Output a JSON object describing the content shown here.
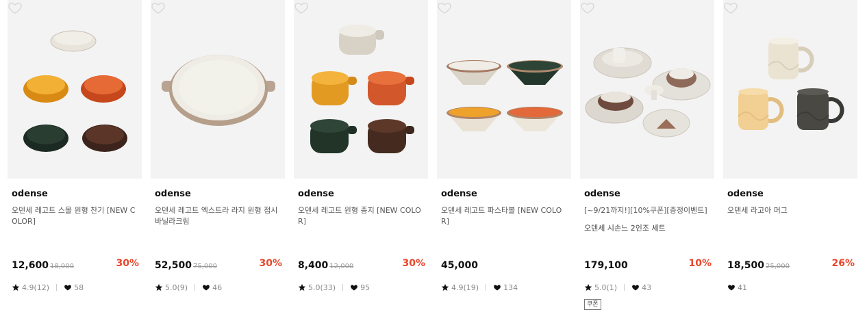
{
  "products": [
    {
      "brand": "odense",
      "title": "오덴세 레고트 스몰 원형 찬기 [NEW COLOR]",
      "price": "12,600",
      "original_price": "18,000",
      "discount": "30%",
      "rating": "4.9(12)",
      "likes": "58",
      "wishlist_icon": "heart-outline-icon"
    },
    {
      "brand": "odense",
      "title": "오덴세 레고트 엑스트라 라지 원형 접시 바닐라크림",
      "price": "52,500",
      "original_price": "75,000",
      "discount": "30%",
      "rating": "5.0(9)",
      "likes": "46",
      "wishlist_icon": "heart-outline-icon"
    },
    {
      "brand": "odense",
      "title": "오덴세 레고트 원형 종지 [NEW COLOR]",
      "price": "8,400",
      "original_price": "12,000",
      "discount": "30%",
      "rating": "5.0(33)",
      "likes": "95",
      "wishlist_icon": "heart-outline-icon"
    },
    {
      "brand": "odense",
      "title": "오덴세 레고트 파스타볼 [NEW COLOR]",
      "price": "45,000",
      "original_price": "",
      "discount": "",
      "rating": "4.9(19)",
      "likes": "134",
      "wishlist_icon": "heart-outline-icon"
    },
    {
      "brand": "odense",
      "title": "[~9/21까지!][10%쿠폰][증정이벤트] I ...",
      "subtitle": "오덴세 시손느 2인조 세트",
      "price": "179,100",
      "original_price": "",
      "discount": "10%",
      "rating": "5.0(1)",
      "likes": "43",
      "badge": "쿠폰",
      "wishlist_icon": "heart-outline-icon"
    },
    {
      "brand": "odense",
      "title": "오덴세 라고아 머그",
      "price": "18,500",
      "original_price": "25,000",
      "discount": "26%",
      "rating": "",
      "likes": "41",
      "wishlist_icon": "heart-outline-icon"
    }
  ],
  "colors": {
    "discount": "#e8472c",
    "thumb_bg": "#f3f3f3"
  }
}
